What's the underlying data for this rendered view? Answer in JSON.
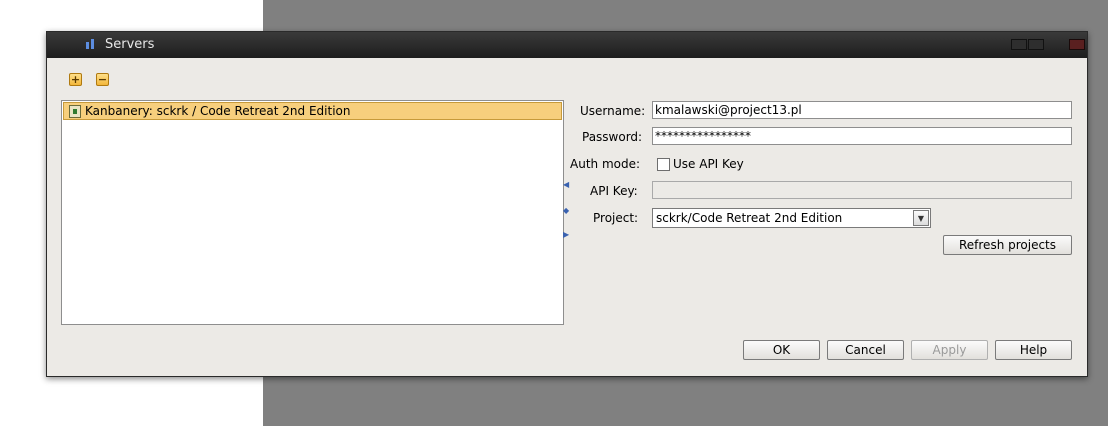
{
  "window": {
    "title": "Servers",
    "icon": "app-icon"
  },
  "toolbar": {
    "add_symbol": "+",
    "remove_symbol": "−"
  },
  "server_list": {
    "items": [
      {
        "label": "Kanbanery: sckrk / Code Retreat 2nd Edition",
        "icon": "server-icon",
        "selected": true
      }
    ]
  },
  "form": {
    "username_label": "Username:",
    "username_value": "kmalawski@project13.pl",
    "password_label": "Password:",
    "password_value": "****************",
    "auth_mode_label": "Auth mode:",
    "use_api_key_label": "Use API Key",
    "use_api_key_checked": false,
    "api_key_label": "API Key:",
    "api_key_value": "",
    "project_label": "Project:",
    "project_value": "sckrk/Code Retreat 2nd Edition",
    "refresh_label": "Refresh projects"
  },
  "buttons": {
    "ok": "OK",
    "cancel": "Cancel",
    "apply": "Apply",
    "help": "Help"
  },
  "colors": {
    "selection": "#f7cf7d",
    "titlebar": "#1d1d1d",
    "dialog_bg": "#eceae6"
  }
}
